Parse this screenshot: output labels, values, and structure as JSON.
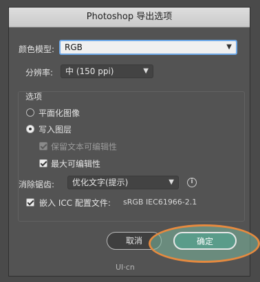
{
  "dialog": {
    "title": "Photoshop 导出选项",
    "color_model_label": "颜色模型:",
    "color_model_value": "RGB",
    "resolution_label": "分辨率:",
    "resolution_value": "中 (150 ppi)",
    "options_title": "选项",
    "radio_flatten": "平面化图像",
    "radio_layers": "写入图层",
    "check_preserve_text": "保留文本可编辑性",
    "check_max_edit": "最大可编辑性",
    "antialias_label": "消除锯齿:",
    "antialias_value": "优化文字(提示)",
    "embed_icc_label": "嵌入 ICC 配置文件:",
    "icc_profile": "sRGB IEC61966-2.1",
    "cancel_label": "取消",
    "ok_label": "确定",
    "watermark": "UI·cn"
  },
  "state": {
    "flatten_selected": false,
    "layers_selected": true,
    "preserve_text_checked": true,
    "preserve_text_enabled": false,
    "max_edit_checked": true,
    "embed_icc_checked": true
  },
  "colors": {
    "highlight": "#e68a3f",
    "ok_button": "#5a9c8a"
  },
  "icons": [
    "chevron-down-icon",
    "info-icon",
    "checkmark-icon",
    "radio-icon"
  ]
}
